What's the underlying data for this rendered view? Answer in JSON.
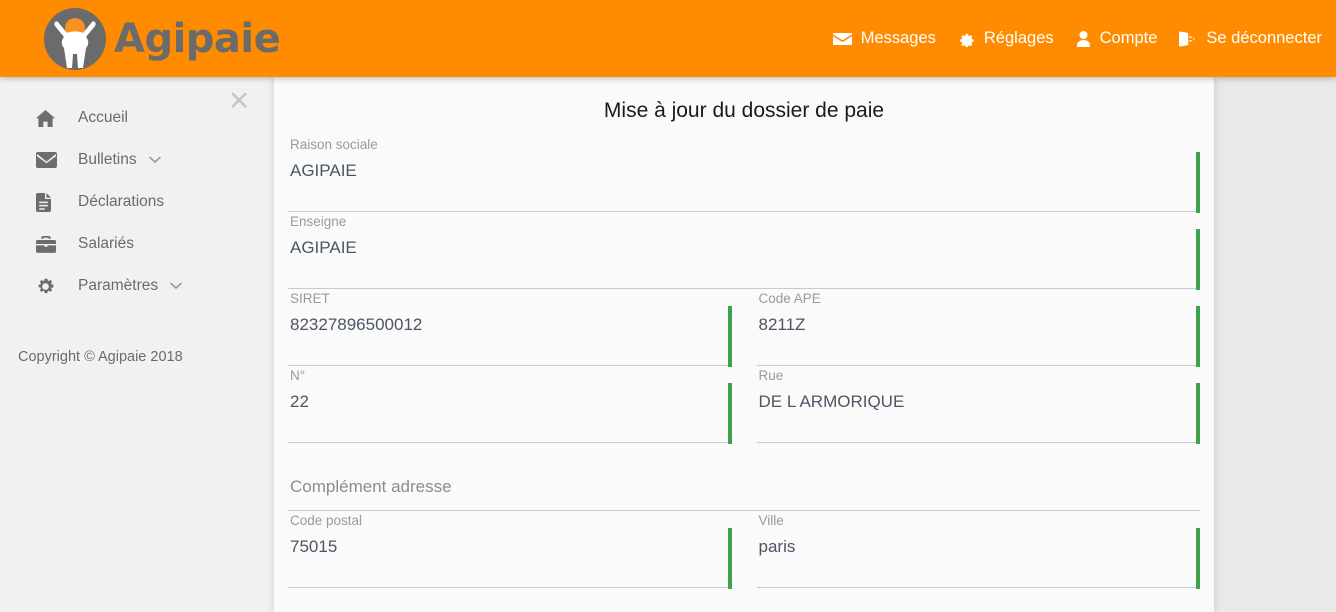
{
  "header": {
    "brand_text": "Agipaie",
    "nav": [
      {
        "label": "Messages",
        "icon": "envelope-icon"
      },
      {
        "label": "Réglages",
        "icon": "gear-icon"
      },
      {
        "label": "Compte",
        "icon": "user-icon"
      },
      {
        "label": "Se déconnecter",
        "icon": "sign-out-icon"
      }
    ]
  },
  "sidebar": {
    "close_label": "✕",
    "items": [
      {
        "label": "Accueil",
        "icon": "home-icon",
        "caret": false
      },
      {
        "label": "Bulletins",
        "icon": "envelope-icon",
        "caret": true
      },
      {
        "label": "Déclarations",
        "icon": "file-icon",
        "caret": false
      },
      {
        "label": "Salariés",
        "icon": "briefcase-icon",
        "caret": false
      },
      {
        "label": "Paramètres",
        "icon": "gear-icon",
        "caret": true
      }
    ],
    "copyright": "Copyright © Agipaie 2018"
  },
  "main": {
    "title": "Mise à jour du dossier de paie",
    "fields": {
      "raison_sociale": {
        "label": "Raison sociale",
        "value": "AGIPAIE",
        "valid": true
      },
      "enseigne": {
        "label": "Enseigne",
        "value": "AGIPAIE",
        "valid": true
      },
      "siret": {
        "label": "SIRET",
        "value": "82327896500012",
        "valid": true
      },
      "code_ape": {
        "label": "Code APE",
        "value": "8211Z",
        "valid": true
      },
      "numero": {
        "label": "N°",
        "value": "22",
        "valid": true
      },
      "rue": {
        "label": "Rue",
        "value": "DE L ARMORIQUE",
        "valid": true
      },
      "complement_adresse": {
        "label": "",
        "value": "Complément adresse",
        "valid": false
      },
      "code_postal": {
        "label": "Code postal",
        "value": "75015",
        "valid": true
      },
      "ville": {
        "label": "Ville",
        "value": "paris",
        "valid": true
      }
    }
  },
  "colors": {
    "brand_orange": "#ff8c00",
    "valid_green": "#40a14b",
    "sidebar_bg": "#f1f1f1",
    "panel_bg": "#fafafa",
    "page_bg": "#e9e9e9",
    "label_grey": "#9a9a9a",
    "value_slate": "#4c5663"
  }
}
